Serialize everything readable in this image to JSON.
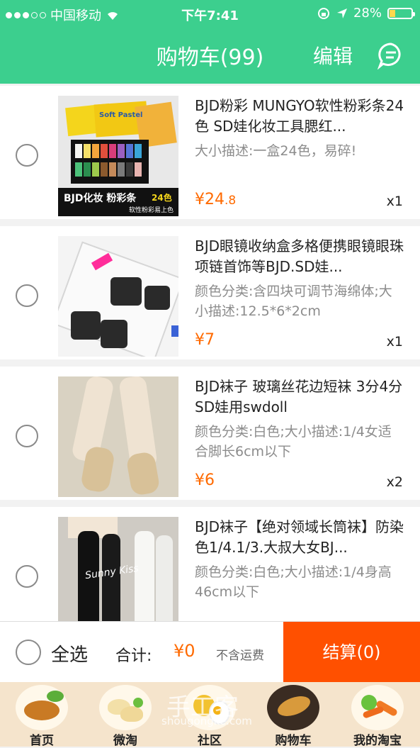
{
  "status_bar": {
    "carrier": "中国移动",
    "time": "下午7:41",
    "battery": "28%",
    "battery_level": 0.28
  },
  "nav": {
    "title": "购物车(99)",
    "edit": "编辑"
  },
  "items": [
    {
      "title": "BJD粉彩 MUNGYO软性粉彩条24色 SD娃化妆工具腮红...",
      "desc": "大小描述:一盒24色，易碎!",
      "price_main": "¥24",
      "price_decimal": ".8",
      "qty": "x1",
      "img_caption": "BJD化妆 粉彩条",
      "img_caption2": "24色",
      "img_sub": "软性粉彩易上色",
      "img_box": "Soft Pastel"
    },
    {
      "title": "BJD眼镜收纳盒多格便携眼镜眼珠项链首饰等BJD.SD娃...",
      "desc": "颜色分类:含四块可调节海绵体;大小描述:12.5*6*2cm",
      "price_main": "¥7",
      "price_decimal": "",
      "qty": "x1"
    },
    {
      "title": "BJD袜子 玻璃丝花边短袜 3分4分SD娃用swdoll",
      "desc": "颜色分类:白色;大小描述:1/4女适合脚长6cm以下",
      "price_main": "¥6",
      "price_decimal": "",
      "qty": "x2"
    },
    {
      "title": "BJD袜子【绝对领域长筒袜】防染色1/4.1/3.大叔大女BJ...",
      "desc": "颜色分类:白色;大小描述:1/4身高46cm以下",
      "img_text": "Sunny Kiss"
    }
  ],
  "bottom": {
    "select_all": "全选",
    "total_label": "合计:",
    "total": "¥0",
    "shipping": "不含运费",
    "checkout": "结算(0)"
  },
  "tabs": [
    {
      "label": "首页",
      "icon": "roast-chicken-icon"
    },
    {
      "label": "微淘",
      "icon": "dumplings-icon"
    },
    {
      "label": "社区",
      "icon": "eggs-icon"
    },
    {
      "label": "购物车",
      "icon": "fish-icon"
    },
    {
      "label": "我的淘宝",
      "icon": "vegetables-icon"
    }
  ],
  "watermark": {
    "text": "手工客",
    "url": "shougongke.com"
  },
  "colors": {
    "brand_green": "#3ccf8e",
    "price_orange": "#ff6a00",
    "checkout_orange": "#ff5000"
  }
}
